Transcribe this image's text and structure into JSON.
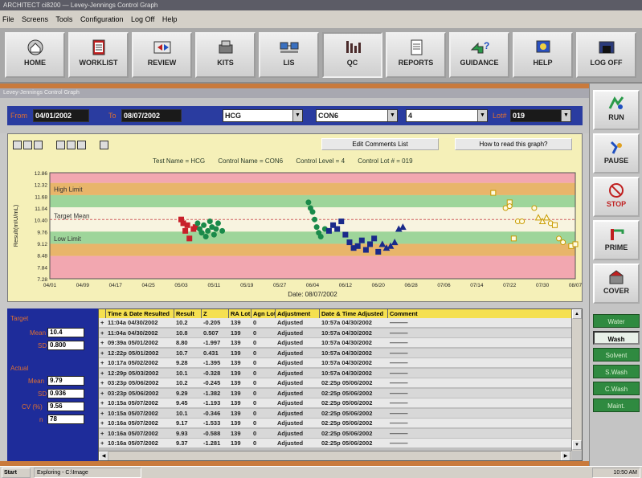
{
  "window": {
    "title": "ARCHITECT ci8200 — Levey-Jennings Control Graph"
  },
  "menu": {
    "items": [
      "File",
      "Screens",
      "Tools",
      "Configuration",
      "Log Off",
      "Help"
    ]
  },
  "toolbar": {
    "buttons": [
      {
        "label": "HOME",
        "icon": "home-icon"
      },
      {
        "label": "WORKLIST",
        "icon": "worklist-icon"
      },
      {
        "label": "REVIEW",
        "icon": "review-icon"
      },
      {
        "label": "KITS",
        "icon": "kits-icon"
      },
      {
        "label": "LIS",
        "icon": "lis-icon"
      },
      {
        "label": "QC",
        "icon": "qc-icon"
      },
      {
        "label": "REPORTS",
        "icon": "reports-icon"
      },
      {
        "label": "GUIDANCE",
        "icon": "guidance-icon"
      },
      {
        "label": "HELP",
        "icon": "help-icon"
      },
      {
        "label": "LOG OFF",
        "icon": "logoff-icon"
      }
    ]
  },
  "subtitle": "Levey-Jennings Control Graph",
  "filters": {
    "from_label": "From",
    "from_value": "04/01/2002",
    "to_label": "To",
    "to_value": "08/07/2002",
    "test_value": "HCG",
    "control_value": "CON6",
    "level_value": "4",
    "lot_label": "Lot#",
    "lot_value": "019"
  },
  "chart_controls": {
    "edit_comments": "Edit Comments List",
    "how_to_read": "How to read this graph?"
  },
  "chart_info": {
    "test_name": "Test Name = HCG",
    "control_name": "Control Name = CON6",
    "control_level": "Control Level = 4",
    "control_lot": "Control Lot # = 019"
  },
  "chart_data": {
    "type": "scatter",
    "ylabel": "Result(mIU/mL)",
    "xlabel": "Date: 08/07/2002",
    "ylim": [
      7.28,
      12.86
    ],
    "yticks": [
      "12.86",
      "12.32",
      "11.68",
      "11.04",
      "10.40",
      "9.76",
      "9.12",
      "8.48",
      "7.84",
      "7.28"
    ],
    "xticks": [
      "04/01",
      "04/09",
      "04/17",
      "04/25",
      "05/03",
      "05/11",
      "05/19",
      "05/27",
      "06/04",
      "06/12",
      "06/20",
      "06/28",
      "07/06",
      "07/14",
      "07/22",
      "07/30",
      "08/07"
    ],
    "bands": [
      {
        "from": 12.32,
        "to": 12.86,
        "color": "#f2a7b0"
      },
      {
        "from": 11.68,
        "to": 12.32,
        "color": "#e8b56a"
      },
      {
        "from": 11.04,
        "to": 11.68,
        "color": "#9ed59a"
      },
      {
        "from": 9.76,
        "to": 11.04,
        "color": "#f8f4e0"
      },
      {
        "from": 9.12,
        "to": 9.76,
        "color": "#9ed59a"
      },
      {
        "from": 8.48,
        "to": 9.12,
        "color": "#e8b56a"
      },
      {
        "from": 7.28,
        "to": 8.48,
        "color": "#f2a7b0"
      }
    ],
    "band_labels": [
      {
        "text": "High Limit",
        "y": 12.0
      },
      {
        "text": "Target Mean",
        "y": 10.6
      },
      {
        "text": "Low Limit",
        "y": 9.4
      }
    ],
    "target_mean": 10.4,
    "series": [
      {
        "marker": "square",
        "color": "#c8202a",
        "points": [
          [
            32,
            10.4
          ],
          [
            32.5,
            10.2
          ],
          [
            33,
            9.8
          ],
          [
            33.5,
            10.1
          ],
          [
            34,
            9.4
          ],
          [
            35,
            9.9
          ],
          [
            35.5,
            10.0
          ]
        ]
      },
      {
        "marker": "circle",
        "color": "#1a8a4a",
        "points": [
          [
            36,
            10.2
          ],
          [
            36.5,
            9.9
          ],
          [
            37,
            9.7
          ],
          [
            37.5,
            10.1
          ],
          [
            38,
            9.5
          ],
          [
            38.5,
            9.8
          ],
          [
            39,
            10.3
          ],
          [
            39.5,
            10.0
          ],
          [
            40,
            9.6
          ],
          [
            40.5,
            9.9
          ],
          [
            41,
            10.2
          ],
          [
            42,
            9.8
          ],
          [
            63,
            11.3
          ],
          [
            63.5,
            11.0
          ],
          [
            64,
            10.8
          ],
          [
            64.5,
            10.4
          ],
          [
            65,
            10.0
          ],
          [
            65.5,
            9.7
          ],
          [
            66,
            9.5
          ],
          [
            67,
            9.9
          ]
        ]
      },
      {
        "marker": "square",
        "color": "#1a2a8a",
        "points": [
          [
            68,
            9.8
          ],
          [
            69,
            10.1
          ],
          [
            70,
            9.9
          ],
          [
            71,
            10.3
          ],
          [
            72,
            9.6
          ],
          [
            73,
            9.2
          ],
          [
            74,
            8.9
          ],
          [
            75,
            9.0
          ],
          [
            76,
            9.3
          ],
          [
            77,
            8.8
          ],
          [
            78,
            9.1
          ],
          [
            79,
            9.4
          ],
          [
            80,
            8.7
          ]
        ]
      },
      {
        "marker": "triangle",
        "color": "#1a2a8a",
        "points": [
          [
            81,
            9.1
          ],
          [
            82,
            8.9
          ],
          [
            83,
            9.0
          ],
          [
            84,
            9.2
          ],
          [
            85,
            9.9
          ],
          [
            86,
            10.0
          ]
        ]
      },
      {
        "marker": "open-square",
        "color": "#c89a00",
        "points": [
          [
            108,
            11.8
          ],
          [
            112,
            11.3
          ],
          [
            113,
            9.4
          ]
        ]
      },
      {
        "marker": "open-circle",
        "color": "#c89a00",
        "points": [
          [
            111,
            11.0
          ],
          [
            112,
            11.1
          ],
          [
            114,
            10.3
          ],
          [
            115,
            10.3
          ],
          [
            118,
            11.0
          ],
          [
            122,
            10.2
          ],
          [
            124,
            9.4
          ],
          [
            125,
            9.2
          ]
        ]
      },
      {
        "marker": "open-triangle",
        "color": "#c89a00",
        "points": [
          [
            119,
            10.5
          ],
          [
            120,
            10.3
          ],
          [
            121,
            10.5
          ]
        ]
      },
      {
        "marker": "open-square",
        "color": "#c89a00",
        "points": [
          [
            123,
            10.1
          ],
          [
            127,
            9.0
          ],
          [
            128,
            9.1
          ]
        ]
      }
    ]
  },
  "stats": {
    "target_label": "Target",
    "mean_label": "Mean",
    "mean_value": "10.4",
    "sd_label": "SD",
    "sd_value": "0.800",
    "actual_label": "Actual",
    "actual_mean_label": "Mean",
    "actual_mean_value": "9.79",
    "actual_sd_label": "SD",
    "actual_sd_value": "0.936",
    "cv_label": "CV (%)",
    "cv_value": "9.56",
    "n_label": "n",
    "n_value": "78"
  },
  "table": {
    "columns": [
      "",
      "Time & Date Resulted",
      "Result",
      "Z",
      "RA Lot",
      "Agn Lot",
      "Adjustment",
      "Date & Time Adjusted",
      "Comment"
    ],
    "rows": [
      [
        "+",
        "11:04a  04/30/2002",
        "10.2",
        "-0.205",
        "139",
        "0",
        "Adjusted",
        "10:57a  04/30/2002",
        "———"
      ],
      [
        "+",
        "11:04a  04/30/2002",
        "10.8",
        "0.507",
        "139",
        "0",
        "Adjusted",
        "10:57a  04/30/2002",
        "———"
      ],
      [
        "+",
        "09:39a  05/01/2002",
        "8.80",
        "-1.997",
        "139",
        "0",
        "Adjusted",
        "10:57a  04/30/2002",
        "———"
      ],
      [
        "+",
        "12:22p  05/01/2002",
        "10.7",
        "0.431",
        "139",
        "0",
        "Adjusted",
        "10:57a  04/30/2002",
        "———"
      ],
      [
        "+",
        "10:17a  05/02/2002",
        "9.28",
        "-1.395",
        "139",
        "0",
        "Adjusted",
        "10:57a  04/30/2002",
        "———"
      ],
      [
        "+",
        "12:29p  05/03/2002",
        "10.1",
        "-0.328",
        "139",
        "0",
        "Adjusted",
        "10:57a  04/30/2002",
        "———"
      ],
      [
        "+",
        "03:23p  05/06/2002",
        "10.2",
        "-0.245",
        "139",
        "0",
        "Adjusted",
        "02:25p  05/06/2002",
        "———"
      ],
      [
        "+",
        "03:23p  05/06/2002",
        "9.29",
        "-1.382",
        "139",
        "0",
        "Adjusted",
        "02:25p  05/06/2002",
        "———"
      ],
      [
        "+",
        "10:15a  05/07/2002",
        "9.45",
        "-1.193",
        "139",
        "0",
        "Adjusted",
        "02:25p  05/06/2002",
        "———"
      ],
      [
        "+",
        "10:15a  05/07/2002",
        "10.1",
        "-0.346",
        "139",
        "0",
        "Adjusted",
        "02:25p  05/06/2002",
        "———"
      ],
      [
        "+",
        "10:16a  05/07/2002",
        "9.17",
        "-1.533",
        "139",
        "0",
        "Adjusted",
        "02:25p  05/06/2002",
        "———"
      ],
      [
        "+",
        "10:16a  05/07/2002",
        "9.93",
        "-0.588",
        "139",
        "0",
        "Adjusted",
        "02:25p  05/06/2002",
        "———"
      ],
      [
        "+",
        "10:16a  05/07/2002",
        "9.37",
        "-1.281",
        "139",
        "0",
        "Adjusted",
        "02:25p  05/06/2002",
        "———"
      ]
    ]
  },
  "side": {
    "run": "RUN",
    "pause": "PAUSE",
    "stop": "STOP",
    "prime": "PRIME",
    "cover": "COVER",
    "small": [
      "Water",
      "Wash",
      "Solvent",
      "S.Wash",
      "C.Wash",
      "Maint."
    ],
    "selected_small": 1
  },
  "taskbar": {
    "start": "Start",
    "task": "Exploring - C:\\Image",
    "clock": "10:50 AM"
  }
}
